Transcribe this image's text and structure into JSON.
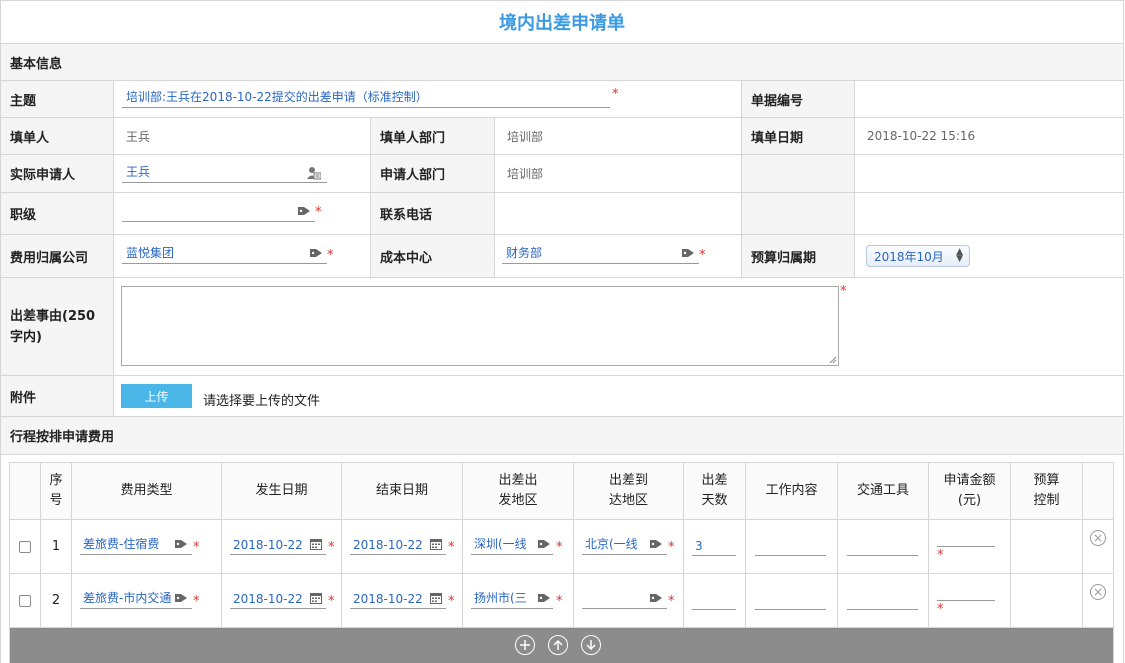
{
  "form": {
    "title": "境内出差申请单",
    "section_basic": "基本信息",
    "section_trip": "行程按排申请费用"
  },
  "fields": {
    "subject_label": "主题",
    "subject_value": "培训部:王兵在2018-10-22提交的出差申请（标准控制）",
    "doc_no_label": "单据编号",
    "doc_no_value": "",
    "filler_label": "填单人",
    "filler_value": "王兵",
    "filler_dept_label": "填单人部门",
    "filler_dept_value": "培训部",
    "fill_date_label": "填单日期",
    "fill_date_value": "2018-10-22 15:16",
    "applicant_label": "实际申请人",
    "applicant_value": "王兵",
    "applicant_dept_label": "申请人部门",
    "applicant_dept_value": "培训部",
    "rank_label": "职级",
    "rank_value": "",
    "phone_label": "联系电话",
    "phone_value": "",
    "company_label": "费用归属公司",
    "company_value": "蓝悦集团",
    "cost_center_label": "成本中心",
    "cost_center_value": "财务部",
    "budget_period_label": "预算归属期",
    "budget_period_value": "2018年10月",
    "reason_label": "出差事由(250字内)",
    "reason_value": "",
    "attachment_label": "附件",
    "upload_button": "上传",
    "upload_hint": "请选择要上传的文件",
    "required_mark": "*"
  },
  "trip_table": {
    "columns": [
      "",
      "序\n号",
      "费用类型",
      "发生日期",
      "结束日期",
      "出差出\n发地区",
      "出差到\n达地区",
      "出差\n天数",
      "工作内容",
      "交通工具",
      "申请金额\n(元)",
      "预算\n控制",
      ""
    ],
    "rows": [
      {
        "no": "1",
        "expense_type": "差旅费-住宿费",
        "start_date": "2018-10-22",
        "end_date": "2018-10-22",
        "from": "深圳(一线",
        "to": "北京(一线",
        "days": "3",
        "work": "",
        "transport": "",
        "amount": "",
        "budget": ""
      },
      {
        "no": "2",
        "expense_type": "差旅费-市内交通",
        "start_date": "2018-10-22",
        "end_date": "2018-10-22",
        "from": "扬州市(三",
        "to": "",
        "days": "",
        "work": "",
        "transport": "",
        "amount": "",
        "budget": ""
      }
    ]
  },
  "colors": {
    "title": "#3b9ae1",
    "link_text": "#2a66c4",
    "required": "#e0312a",
    "upload_button": "#4ab7e8",
    "toolbar": "#8c8c8c"
  },
  "icons": {
    "tag": "tag-icon",
    "contact": "contact-card-icon",
    "calendar": "calendar-icon",
    "add": "add-row-icon",
    "up": "move-up-icon",
    "down": "move-down-icon",
    "delete": "delete-row-icon"
  }
}
